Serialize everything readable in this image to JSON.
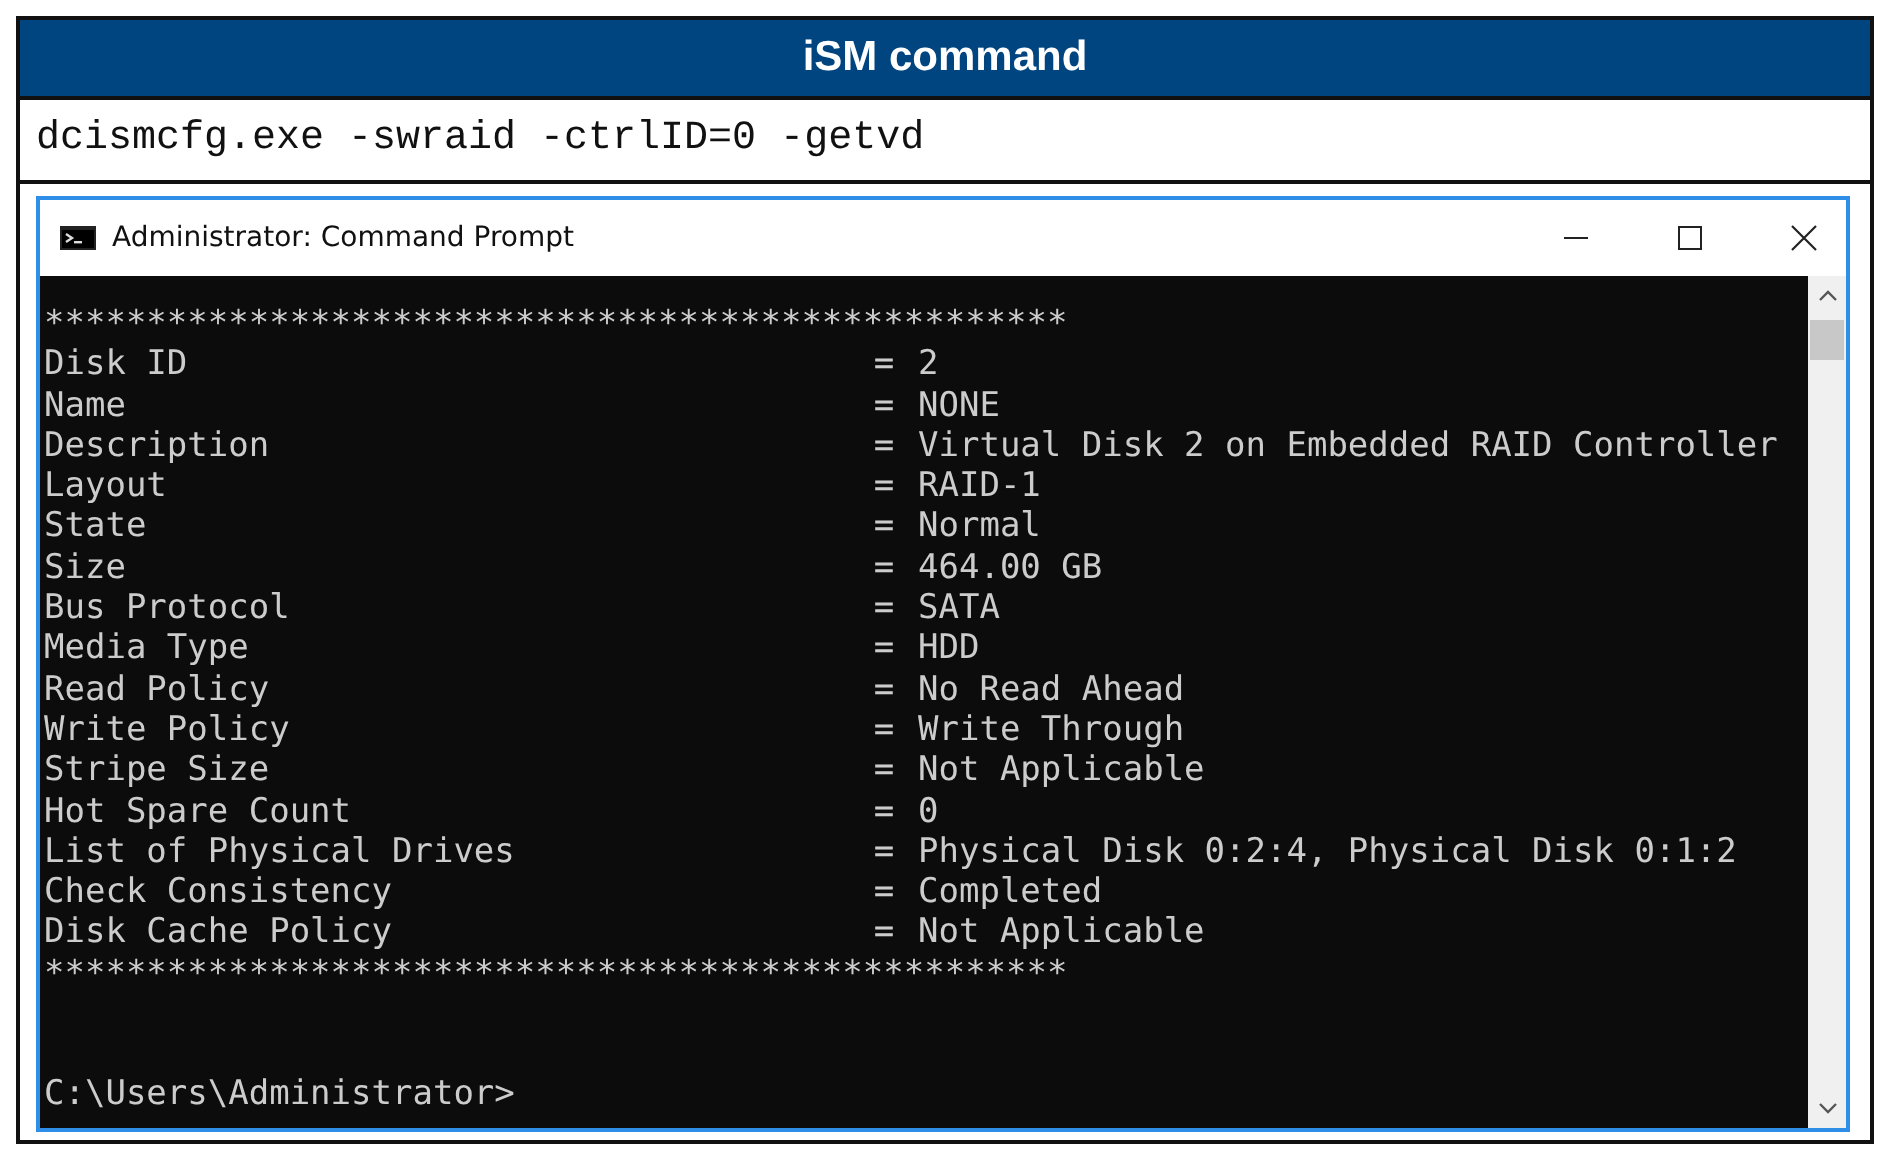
{
  "header": {
    "title": "iSM command"
  },
  "command": "dcismcfg.exe -swraid -ctrlID=0 -getvd",
  "window": {
    "title": "Administrator: Command Prompt"
  },
  "console": {
    "separator_top": "**************************************************",
    "rows": [
      {
        "label": "Disk ID",
        "sign": "=",
        "value": "2"
      },
      {
        "label": "Name",
        "sign": "=",
        "value": "NONE"
      },
      {
        "label": "Description",
        "sign": "=",
        "value": "Virtual Disk 2 on Embedded RAID Controller"
      },
      {
        "label": "Layout",
        "sign": "=",
        "value": "RAID-1"
      },
      {
        "label": "State",
        "sign": "=",
        "value": "Normal"
      },
      {
        "label": "Size",
        "sign": "=",
        "value": "464.00 GB"
      },
      {
        "label": "Bus Protocol",
        "sign": "=",
        "value": "SATA"
      },
      {
        "label": "Media Type",
        "sign": "=",
        "value": "HDD"
      },
      {
        "label": "Read Policy",
        "sign": "=",
        "value": "No Read Ahead"
      },
      {
        "label": "Write Policy",
        "sign": "=",
        "value": "Write Through"
      },
      {
        "label": "Stripe Size",
        "sign": "=",
        "value": "Not Applicable"
      },
      {
        "label": "Hot Spare Count",
        "sign": "=",
        "value": "0"
      },
      {
        "label": "List of Physical Drives",
        "sign": "=",
        "value": "Physical Disk 0:2:4, Physical Disk 0:1:2"
      },
      {
        "label": "Check Consistency",
        "sign": "=",
        "value": "Completed"
      },
      {
        "label": "Disk Cache Policy",
        "sign": "=",
        "value": "Not Applicable"
      }
    ],
    "separator_bottom": "**************************************************",
    "prompt": "C:\\Users\\Administrator>"
  }
}
